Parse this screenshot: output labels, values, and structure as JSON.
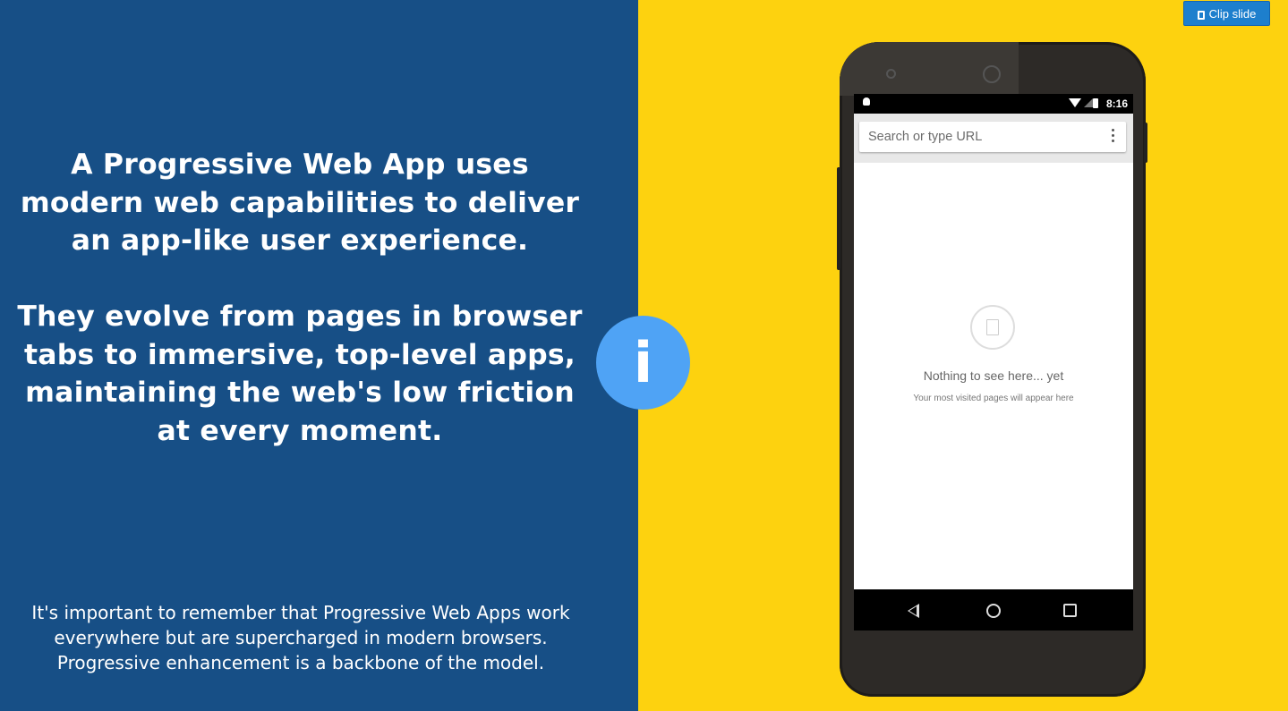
{
  "slide": {
    "heading_1": "A Progressive Web App uses modern web capabilities to deliver an app-like user experience.",
    "heading_2": "They evolve from pages in browser tabs to immersive, top-level apps, maintaining the web's low friction at every moment.",
    "footer": "It's important to remember that Progressive Web Apps work everywhere but are supercharged in modern browsers. Progressive enhancement is a backbone of the model.",
    "info_symbol": "i",
    "colors": {
      "left_bg": "#174f86",
      "right_bg": "#fdd20f",
      "info_circle": "#4fa3f5"
    }
  },
  "toolbar": {
    "clip_label": "Clip slide",
    "clip_icon": "clip-icon"
  },
  "phone": {
    "time": "8:16",
    "url_placeholder": "Search or type URL",
    "empty_title": "Nothing to see here... yet",
    "empty_subtitle": "Your most visited pages will appear here",
    "icons": [
      "bookmark-star-icon",
      "history-clock-icon",
      "back-icon",
      "home-icon",
      "recents-icon"
    ]
  }
}
